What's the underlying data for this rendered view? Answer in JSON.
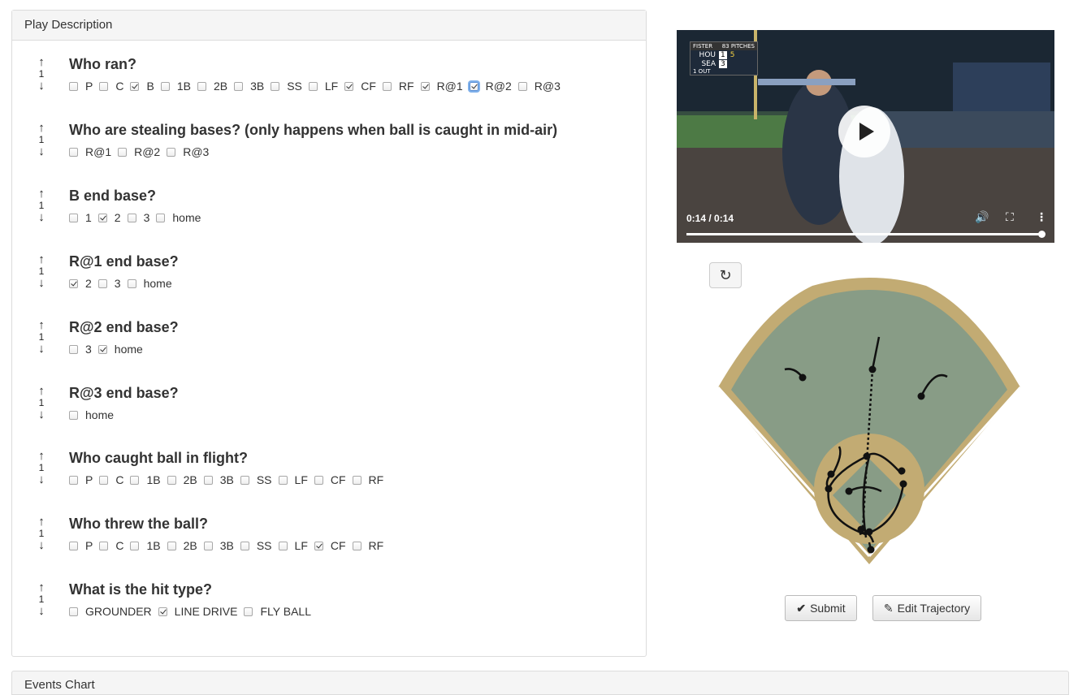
{
  "play_panel": {
    "title": "Play Description",
    "questions": [
      {
        "title": "Who ran?",
        "order": "1",
        "options": [
          {
            "label": "P",
            "checked": false
          },
          {
            "label": "C",
            "checked": false
          },
          {
            "label": "B",
            "checked": true
          },
          {
            "label": "1B",
            "checked": false
          },
          {
            "label": "2B",
            "checked": false
          },
          {
            "label": "3B",
            "checked": false
          },
          {
            "label": "SS",
            "checked": false
          },
          {
            "label": "LF",
            "checked": false
          },
          {
            "label": "CF",
            "checked": true
          },
          {
            "label": "RF",
            "checked": false
          },
          {
            "label": "R@1",
            "checked": true
          },
          {
            "label": "R@2",
            "checked": true,
            "focused": true
          },
          {
            "label": "R@3",
            "checked": false
          }
        ]
      },
      {
        "title": "Who are stealing bases? (only happens when ball is caught in mid-air)",
        "order": "1",
        "options": [
          {
            "label": "R@1",
            "checked": false
          },
          {
            "label": "R@2",
            "checked": false
          },
          {
            "label": "R@3",
            "checked": false
          }
        ]
      },
      {
        "title": "B end base?",
        "order": "1",
        "options": [
          {
            "label": "1",
            "checked": false
          },
          {
            "label": "2",
            "checked": true
          },
          {
            "label": "3",
            "checked": false
          },
          {
            "label": "home",
            "checked": false
          }
        ]
      },
      {
        "title": "R@1 end base?",
        "order": "1",
        "options": [
          {
            "label": "2",
            "checked": true
          },
          {
            "label": "3",
            "checked": false
          },
          {
            "label": "home",
            "checked": false
          }
        ]
      },
      {
        "title": "R@2 end base?",
        "order": "1",
        "options": [
          {
            "label": "3",
            "checked": false
          },
          {
            "label": "home",
            "checked": true
          }
        ]
      },
      {
        "title": "R@3 end base?",
        "order": "1",
        "options": [
          {
            "label": "home",
            "checked": false
          }
        ]
      },
      {
        "title": "Who caught ball in flight?",
        "order": "1",
        "options": [
          {
            "label": "P",
            "checked": false
          },
          {
            "label": "C",
            "checked": false
          },
          {
            "label": "1B",
            "checked": false
          },
          {
            "label": "2B",
            "checked": false
          },
          {
            "label": "3B",
            "checked": false
          },
          {
            "label": "SS",
            "checked": false
          },
          {
            "label": "LF",
            "checked": false
          },
          {
            "label": "CF",
            "checked": false
          },
          {
            "label": "RF",
            "checked": false
          }
        ]
      },
      {
        "title": "Who threw the ball?",
        "order": "1",
        "options": [
          {
            "label": "P",
            "checked": false
          },
          {
            "label": "C",
            "checked": false
          },
          {
            "label": "1B",
            "checked": false
          },
          {
            "label": "2B",
            "checked": false
          },
          {
            "label": "3B",
            "checked": false
          },
          {
            "label": "SS",
            "checked": false
          },
          {
            "label": "LF",
            "checked": false
          },
          {
            "label": "CF",
            "checked": true
          },
          {
            "label": "RF",
            "checked": false
          }
        ]
      },
      {
        "title": "What is the hit type?",
        "order": "1",
        "options": [
          {
            "label": "GROUNDER",
            "checked": false
          },
          {
            "label": "LINE DRIVE",
            "checked": true
          },
          {
            "label": "FLY BALL",
            "checked": false
          }
        ]
      }
    ]
  },
  "video": {
    "time": "0:14 / 0:14",
    "progress": 1.0,
    "scorebug": {
      "pitcher": "FISTER",
      "pitches": "83 PITCHES",
      "away": "HOU",
      "home": "SEA",
      "away_score": "1",
      "home_score": "3",
      "inning": "5",
      "outs": "1 OUT"
    }
  },
  "buttons": {
    "submit": "Submit",
    "edit_trajectory": "Edit Trajectory"
  },
  "events_panel": {
    "title": "Events Chart"
  },
  "colors": {
    "field_grass": "#889c86",
    "field_dirt": "#c2ab73",
    "field_edge": "#bfa978"
  }
}
